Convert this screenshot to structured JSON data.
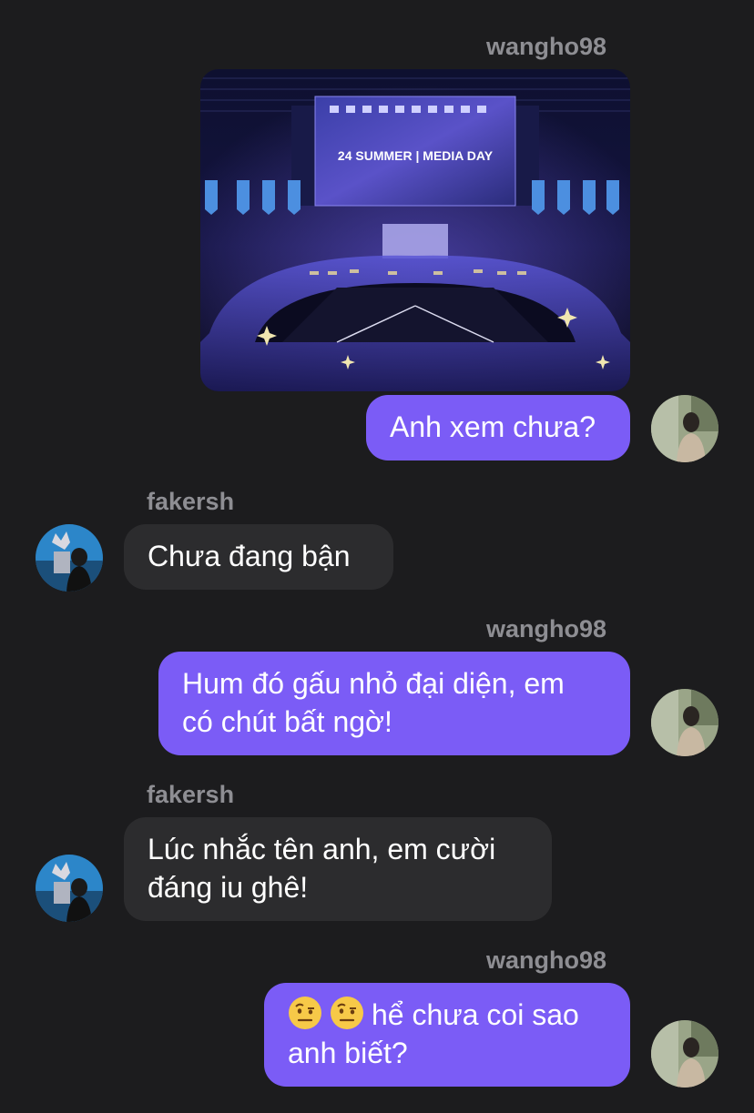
{
  "messages": [
    {
      "sender": "wangho98",
      "type": "image",
      "image_caption": "24 SUMMER | MEDIA DAY"
    },
    {
      "sender": "wangho98",
      "type": "text",
      "text": "Anh xem chưa?"
    },
    {
      "sender": "fakersh",
      "type": "text",
      "text": "Chưa đang bận"
    },
    {
      "sender": "wangho98",
      "type": "text",
      "text_line1": "Hum đó gấu nhỏ đại diện, em",
      "text_line2": "có chút bất ngờ!"
    },
    {
      "sender": "fakersh",
      "type": "text",
      "text_line1": "Lúc nhắc tên anh, em cười",
      "text_line2": "đáng iu ghê!"
    },
    {
      "sender": "wangho98",
      "type": "text",
      "text_line1": "hể chưa coi sao",
      "text_line2": "anh biết?",
      "emojis": [
        "face-with-raised-eyebrow",
        "face-with-raised-eyebrow"
      ]
    }
  ],
  "colors": {
    "background": "#1c1c1e",
    "outgoing_bubble": "#7b5cf6",
    "incoming_bubble": "#2c2c2e",
    "username": "#8e8e93"
  }
}
